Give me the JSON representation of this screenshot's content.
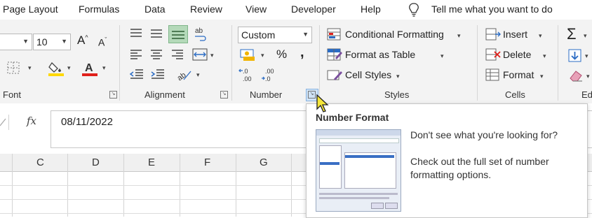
{
  "tabs": [
    "Page Layout",
    "Formulas",
    "Data",
    "Review",
    "View",
    "Developer",
    "Help"
  ],
  "tell_me": "Tell me what you want to do",
  "font": {
    "size": "10",
    "group_label": "Font"
  },
  "alignment": {
    "group_label": "Alignment"
  },
  "number": {
    "format_value": "Custom",
    "percent": "%",
    "comma": ",",
    "inc_decimal": "←.0 .00",
    "dec_decimal": ".00 →.0",
    "group_label": "Number"
  },
  "styles": {
    "conditional": "Conditional Formatting",
    "format_table": "Format as Table",
    "cell_styles": "Cell Styles",
    "group_label": "Styles"
  },
  "cells": {
    "insert": "Insert",
    "delete": "Delete",
    "format": "Format",
    "group_label": "Cells"
  },
  "editing": {
    "group_label": "Ed"
  },
  "formula_bar": {
    "fx": "fx",
    "value": "08/11/2022"
  },
  "columns": [
    "C",
    "D",
    "E",
    "F",
    "G"
  ],
  "tooltip": {
    "title": "Number Format",
    "line1": "Don't see what you're looking for?",
    "line2": "Check out the full set of number formatting options."
  },
  "colors": {
    "fill_yellow": "#ffd800",
    "font_red": "#e0201b",
    "ribbon_bg": "#f3f3f3",
    "accent_green": "#217346"
  }
}
